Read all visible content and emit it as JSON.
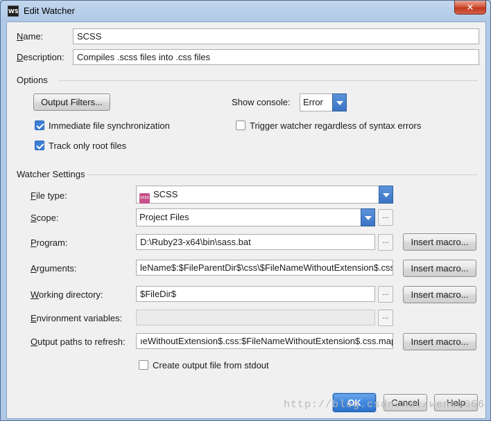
{
  "window": {
    "title": "Edit Watcher",
    "app_icon": "WS",
    "close_label": "✕"
  },
  "name": {
    "label_u": "N",
    "label_rest": "ame:",
    "value": "SCSS"
  },
  "description": {
    "label_u": "D",
    "label_rest": "escription:",
    "value": "Compiles .scss files into .css files"
  },
  "options": {
    "header": "Options",
    "output_filters_label": "Output Filters...",
    "show_console_label": "Show console:",
    "show_console_value": "Error",
    "immediate_sync_label": "Immediate file synchronization",
    "immediate_sync_checked": true,
    "track_root_label": "Track only root files",
    "track_root_checked": true,
    "trigger_label": "Trigger watcher regardless of syntax errors",
    "trigger_checked": false
  },
  "watcher_settings": {
    "header": "Watcher Settings",
    "file_type": {
      "label_u": "F",
      "label_rest": "ile type:",
      "value": "SCSS",
      "icon": "sass-icon",
      "icon_text": "SASS"
    },
    "scope": {
      "label_u": "S",
      "label_rest": "cope:",
      "value": "Project Files"
    },
    "program": {
      "label_u": "P",
      "label_rest": "rogram:",
      "value": "D:\\Ruby23-x64\\bin\\sass.bat"
    },
    "arguments": {
      "label_u": "A",
      "label_rest": "rguments:",
      "value": "leName$:$FileParentDir$\\css\\$FileNameWithoutExtension$.css"
    },
    "working_directory": {
      "label_u": "W",
      "label_rest": "orking directory:",
      "value": "$FileDir$"
    },
    "environment_variables": {
      "label_u": "E",
      "label_rest": "nvironment variables:",
      "value": ""
    },
    "output_paths": {
      "label_u": "O",
      "label_rest": "utput paths to refresh:",
      "value": "ıeWithoutExtension$.css:$FileNameWithoutExtension$.css.map"
    },
    "insert_macro_label": "Insert macro...",
    "ellipsis": "...",
    "create_output_label": "Create output file from stdout",
    "create_output_checked": false
  },
  "footer": {
    "ok_label": "OK",
    "cancel_label": "Cancel",
    "help_label": "Help"
  },
  "watermark": "http://blog.csdn.net/wenbo666"
}
